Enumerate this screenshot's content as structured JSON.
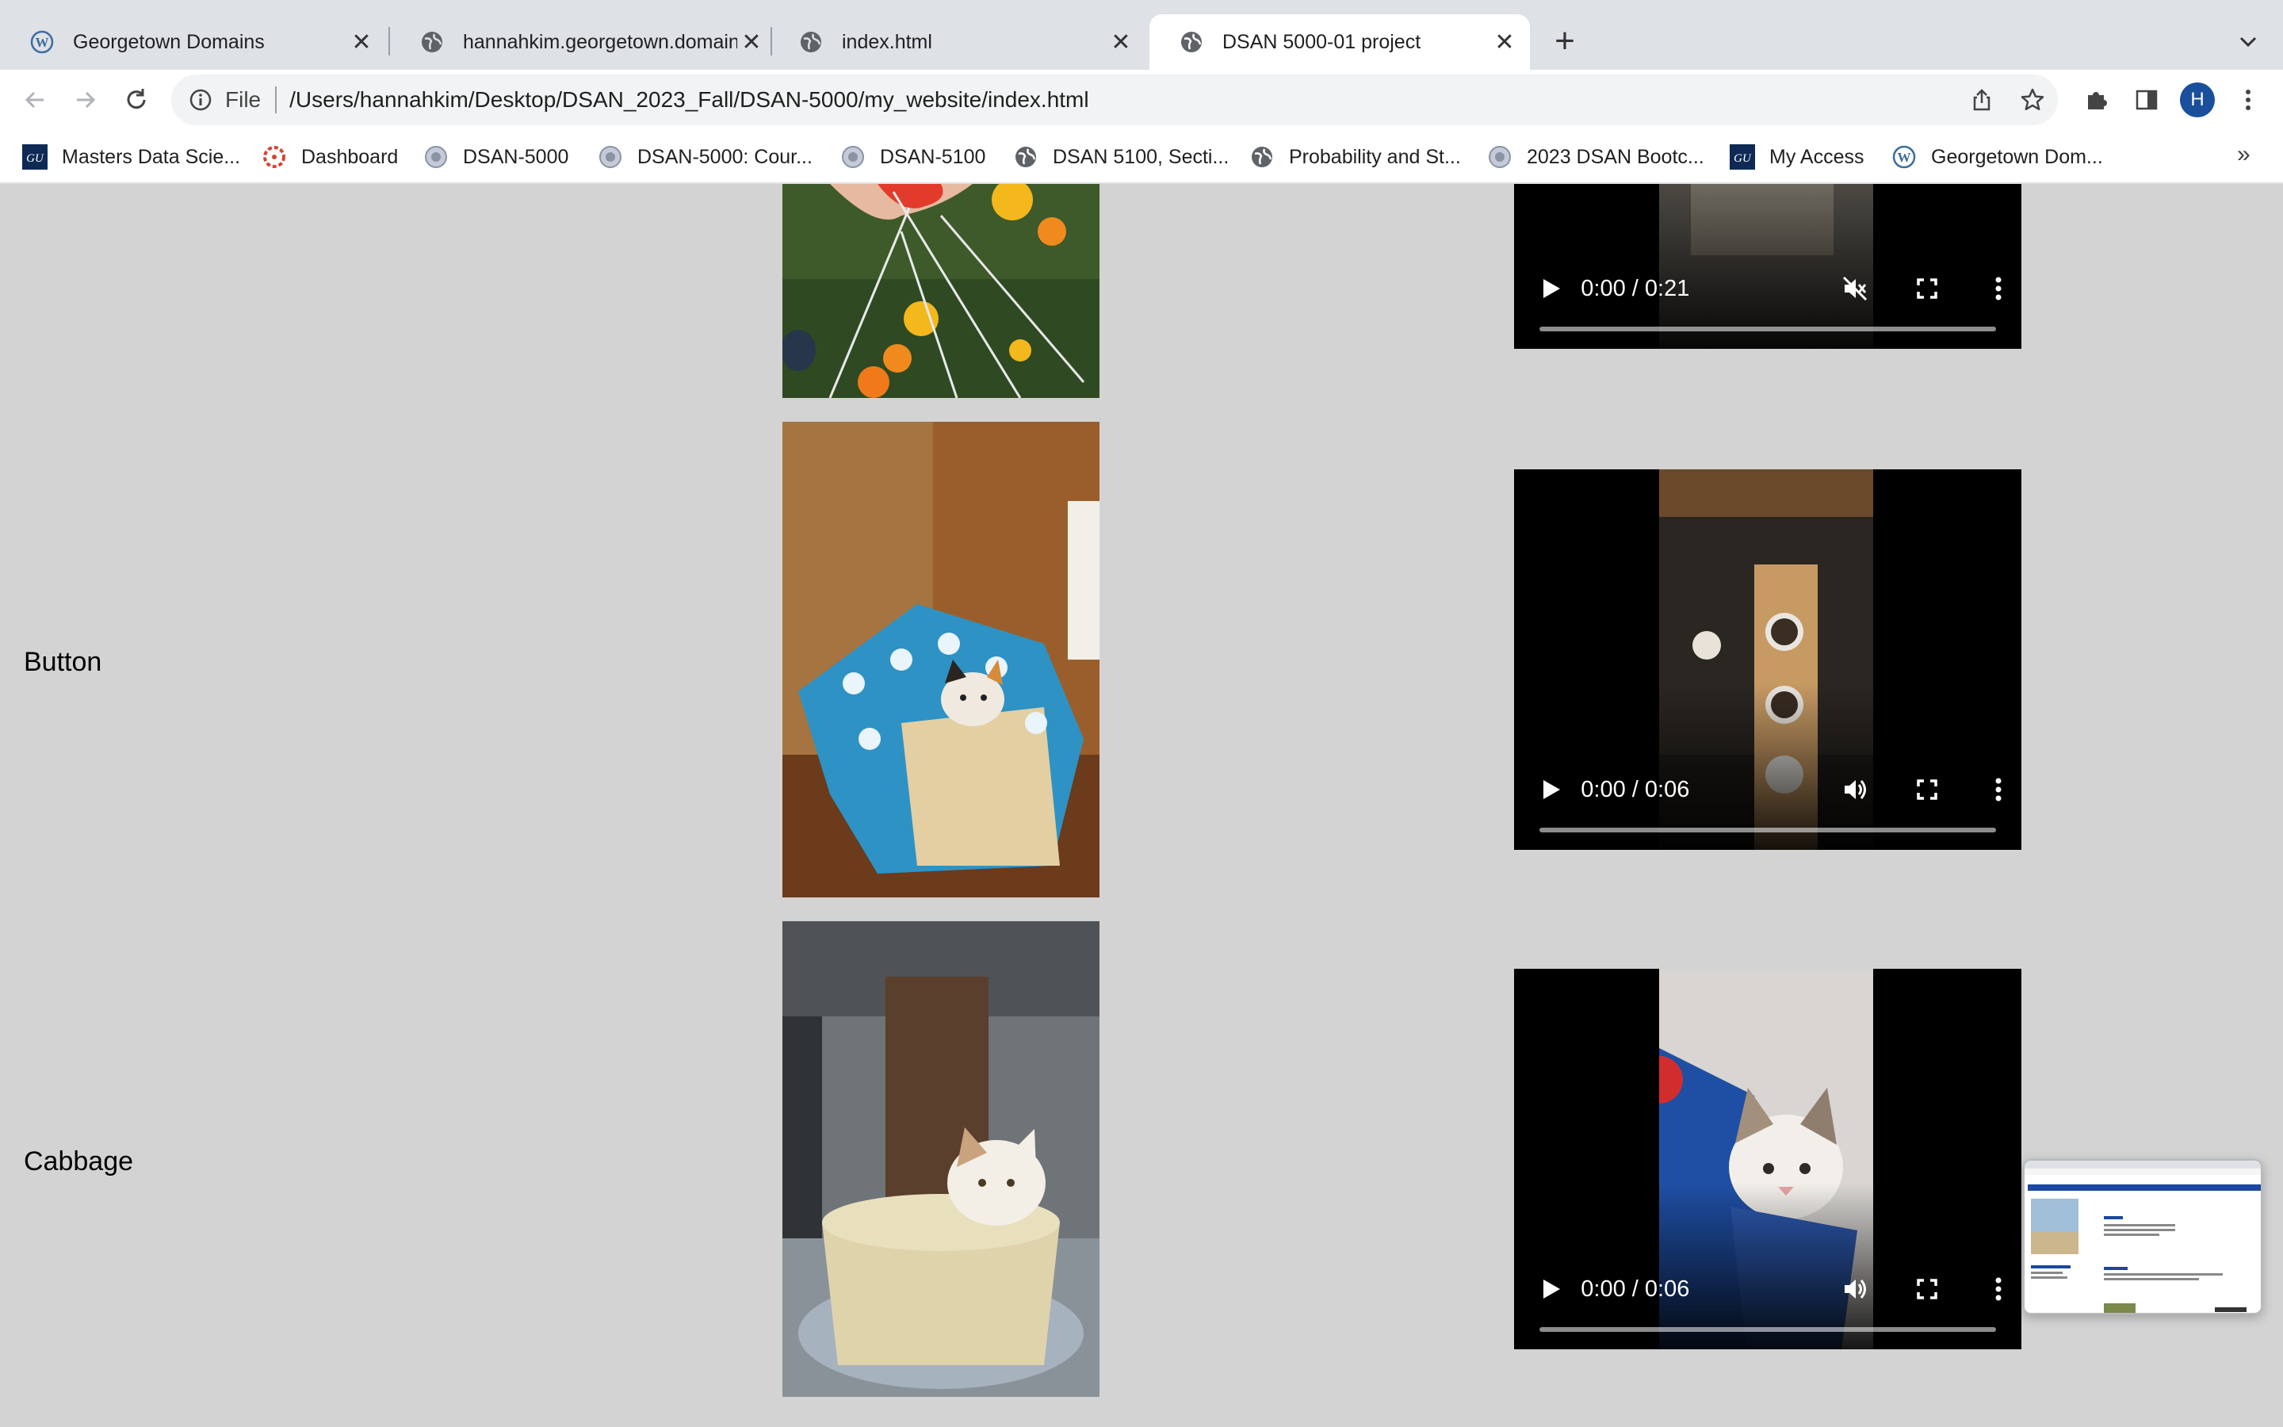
{
  "browser": {
    "tabs": [
      {
        "title": "Georgetown Domains",
        "icon": "wordpress-icon"
      },
      {
        "title": "hannahkim.georgetown.domain",
        "icon": "globe-icon"
      },
      {
        "title": "index.html",
        "icon": "globe-icon"
      },
      {
        "title": "DSAN 5000-01 project",
        "icon": "globe-icon",
        "active": true
      }
    ],
    "address": {
      "scheme_label": "File",
      "url": "/Users/hannahkim/Desktop/DSAN_2023_Fall/DSAN-5000/my_website/index.html"
    },
    "profile_initial": "H",
    "bookmarks": [
      {
        "label": "Masters Data Scie...",
        "icon": "georgetown-gu-icon"
      },
      {
        "label": "Dashboard",
        "icon": "canvas-icon"
      },
      {
        "label": "DSAN-5000",
        "icon": "georgetown-seal-icon"
      },
      {
        "label": "DSAN-5000: Cour...",
        "icon": "georgetown-seal-icon"
      },
      {
        "label": "DSAN-5100",
        "icon": "georgetown-seal-icon"
      },
      {
        "label": "DSAN 5100, Secti...",
        "icon": "globe-icon"
      },
      {
        "label": "Probability and St...",
        "icon": "globe-icon"
      },
      {
        "label": "2023 DSAN Bootc...",
        "icon": "georgetown-seal-icon"
      },
      {
        "label": "My Access",
        "icon": "georgetown-gu-icon"
      },
      {
        "label": "Georgetown Dom...",
        "icon": "wordpress-icon"
      }
    ],
    "bookmarks_overflow": "»"
  },
  "page": {
    "rows": [
      {
        "label": "",
        "photo": "flowers-and-hand-photo",
        "video_time": "0:00 / 0:21",
        "muted": true
      },
      {
        "label": "Button",
        "photo": "kitten-in-basket-photo",
        "video_time": "0:00 / 0:06",
        "muted": false
      },
      {
        "label": "Cabbage",
        "photo": "kitten-in-round-bed-photo",
        "video_time": "0:00 / 0:06",
        "muted": false
      }
    ]
  },
  "colors": {
    "page_bg": "#d3d3d3",
    "tabstrip_bg": "#dee1e6",
    "profile": "#1a4f9c"
  }
}
